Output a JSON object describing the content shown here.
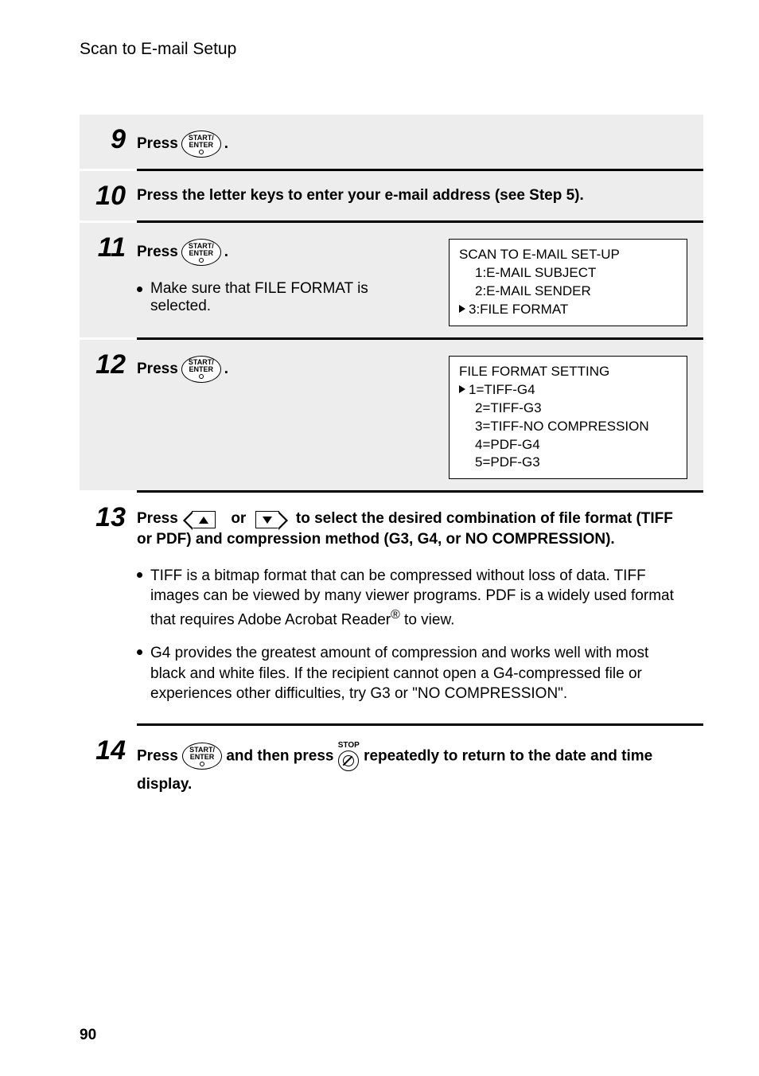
{
  "header": "Scan to E-mail Setup",
  "btn": {
    "start_enter_top": "START/",
    "start_enter_bottom": "ENTER",
    "stop": "STOP"
  },
  "steps": {
    "s9": {
      "num": "9",
      "press": "Press ",
      "dot": "."
    },
    "s10": {
      "num": "10",
      "text": "Press the letter keys to enter your e-mail address (see Step 5)."
    },
    "s11": {
      "num": "11",
      "press": "Press ",
      "dot": ".",
      "bullet": "Make sure that FILE FORMAT is selected.",
      "box": {
        "l1": "SCAN TO E-MAIL SET-UP",
        "l2": "1:E-MAIL SUBJECT",
        "l3": "2:E-MAIL SENDER",
        "l4": "3:FILE FORMAT"
      }
    },
    "s12": {
      "num": "12",
      "press": "Press ",
      "dot": ".",
      "box": {
        "l1": "FILE FORMAT SETTING",
        "l2": "1=TIFF-G4",
        "l3": "2=TIFF-G3",
        "l4": "3=TIFF-NO COMPRESSION",
        "l5": "4=PDF-G4",
        "l6": "5=PDF-G3"
      }
    },
    "s13": {
      "num": "13",
      "t1": "Press ",
      "t2": " or ",
      "t3": " to select the desired combination of file format (TIFF or PDF) and compression method (G3, G4, or NO COMPRESSION).",
      "b1a": "TIFF is a bitmap format that can be compressed without loss of data. TIFF images can be viewed by many viewer programs. PDF is a widely used format that requires Adobe Acrobat Reader",
      "b1b": " to view.",
      "reg": "®",
      "b2": "G4 provides the greatest amount of compression and works well with most black and white files. If the recipient cannot open a G4-compressed file or experiences other difficulties, try G3 or \"NO COMPRESSION\"."
    },
    "s14": {
      "num": "14",
      "t1": "Press ",
      "t2": " and then press  ",
      "t3": "  repeatedly to return to the date and time display."
    }
  },
  "pageNum": "90"
}
